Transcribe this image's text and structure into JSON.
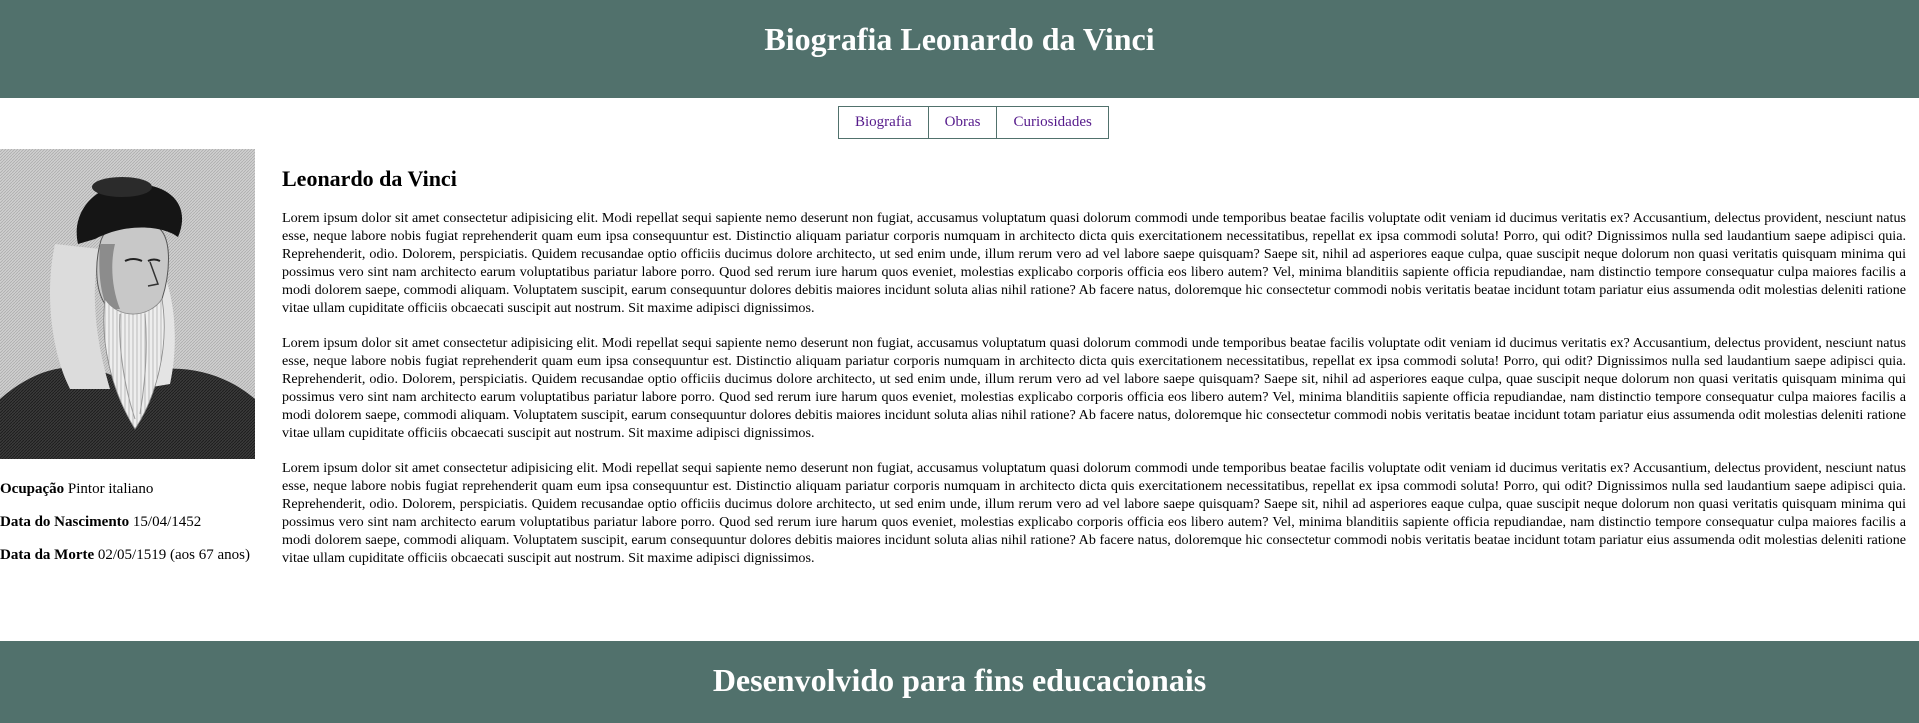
{
  "header": {
    "title": "Biografia Leonardo da Vinci"
  },
  "nav": {
    "items": [
      {
        "label": "Biografia"
      },
      {
        "label": "Obras"
      },
      {
        "label": "Curiosidades"
      }
    ]
  },
  "profile": {
    "occupation_label": "Ocupação",
    "occupation_value": "Pintor italiano",
    "birth_label": "Data do Nascimento",
    "birth_value": "15/04/1452",
    "death_label": "Data da Morte",
    "death_value": "02/05/1519 (aos 67 anos)"
  },
  "main": {
    "heading": "Leonardo da Vinci",
    "paragraphs": [
      "Lorem ipsum dolor sit amet consectetur adipisicing elit. Modi repellat sequi sapiente nemo deserunt non fugiat, accusamus voluptatum quasi dolorum commodi unde temporibus beatae facilis voluptate odit veniam id ducimus veritatis ex? Accusantium, delectus provident, nesciunt natus esse, neque labore nobis fugiat reprehenderit quam eum ipsa consequuntur est. Distinctio aliquam pariatur corporis numquam in architecto dicta quis exercitationem necessitatibus, repellat ex ipsa commodi soluta! Porro, qui odit? Dignissimos nulla sed laudantium saepe adipisci quia. Reprehenderit, odio. Dolorem, perspiciatis. Quidem recusandae optio officiis ducimus dolore architecto, ut sed enim unde, illum rerum vero ad vel labore saepe quisquam? Saepe sit, nihil ad asperiores eaque culpa, quae suscipit neque dolorum non quasi veritatis quisquam minima qui possimus vero sint nam architecto earum voluptatibus pariatur labore porro. Quod sed rerum iure harum quos eveniet, molestias explicabo corporis officia eos libero autem? Vel, minima blanditiis sapiente officia repudiandae, nam distinctio tempore consequatur culpa maiores facilis a modi dolorem saepe, commodi aliquam. Voluptatem suscipit, earum consequuntur dolores debitis maiores incidunt soluta alias nihil ratione? Ab facere natus, doloremque hic consectetur commodi nobis veritatis beatae incidunt totam pariatur eius assumenda odit molestias deleniti ratione vitae ullam cupiditate officiis obcaecati suscipit aut nostrum. Sit maxime adipisci dignissimos.",
      "Lorem ipsum dolor sit amet consectetur adipisicing elit. Modi repellat sequi sapiente nemo deserunt non fugiat, accusamus voluptatum quasi dolorum commodi unde temporibus beatae facilis voluptate odit veniam id ducimus veritatis ex? Accusantium, delectus provident, nesciunt natus esse, neque labore nobis fugiat reprehenderit quam eum ipsa consequuntur est. Distinctio aliquam pariatur corporis numquam in architecto dicta quis exercitationem necessitatibus, repellat ex ipsa commodi soluta! Porro, qui odit? Dignissimos nulla sed laudantium saepe adipisci quia. Reprehenderit, odio. Dolorem, perspiciatis. Quidem recusandae optio officiis ducimus dolore architecto, ut sed enim unde, illum rerum vero ad vel labore saepe quisquam? Saepe sit, nihil ad asperiores eaque culpa, quae suscipit neque dolorum non quasi veritatis quisquam minima qui possimus vero sint nam architecto earum voluptatibus pariatur labore porro. Quod sed rerum iure harum quos eveniet, molestias explicabo corporis officia eos libero autem? Vel, minima blanditiis sapiente officia repudiandae, nam distinctio tempore consequatur culpa maiores facilis a modi dolorem saepe, commodi aliquam. Voluptatem suscipit, earum consequuntur dolores debitis maiores incidunt soluta alias nihil ratione? Ab facere natus, doloremque hic consectetur commodi nobis veritatis beatae incidunt totam pariatur eius assumenda odit molestias deleniti ratione vitae ullam cupiditate officiis obcaecati suscipit aut nostrum. Sit maxime adipisci dignissimos.",
      "Lorem ipsum dolor sit amet consectetur adipisicing elit. Modi repellat sequi sapiente nemo deserunt non fugiat, accusamus voluptatum quasi dolorum commodi unde temporibus beatae facilis voluptate odit veniam id ducimus veritatis ex? Accusantium, delectus provident, nesciunt natus esse, neque labore nobis fugiat reprehenderit quam eum ipsa consequuntur est. Distinctio aliquam pariatur corporis numquam in architecto dicta quis exercitationem necessitatibus, repellat ex ipsa commodi soluta! Porro, qui odit? Dignissimos nulla sed laudantium saepe adipisci quia. Reprehenderit, odio. Dolorem, perspiciatis. Quidem recusandae optio officiis ducimus dolore architecto, ut sed enim unde, illum rerum vero ad vel labore saepe quisquam? Saepe sit, nihil ad asperiores eaque culpa, quae suscipit neque dolorum non quasi veritatis quisquam minima qui possimus vero sint nam architecto earum voluptatibus pariatur labore porro. Quod sed rerum iure harum quos eveniet, molestias explicabo corporis officia eos libero autem? Vel, minima blanditiis sapiente officia repudiandae, nam distinctio tempore consequatur culpa maiores facilis a modi dolorem saepe, commodi aliquam. Voluptatem suscipit, earum consequuntur dolores debitis maiores incidunt soluta alias nihil ratione? Ab facere natus, doloremque hic consectetur commodi nobis veritatis beatae incidunt totam pariatur eius assumenda odit molestias deleniti ratione vitae ullam cupiditate officiis obcaecati suscipit aut nostrum. Sit maxime adipisci dignissimos."
    ]
  },
  "footer": {
    "text": "Desenvolvido para fins educacionais"
  },
  "colors": {
    "bar": "#51716c",
    "link": "#551a8b"
  }
}
